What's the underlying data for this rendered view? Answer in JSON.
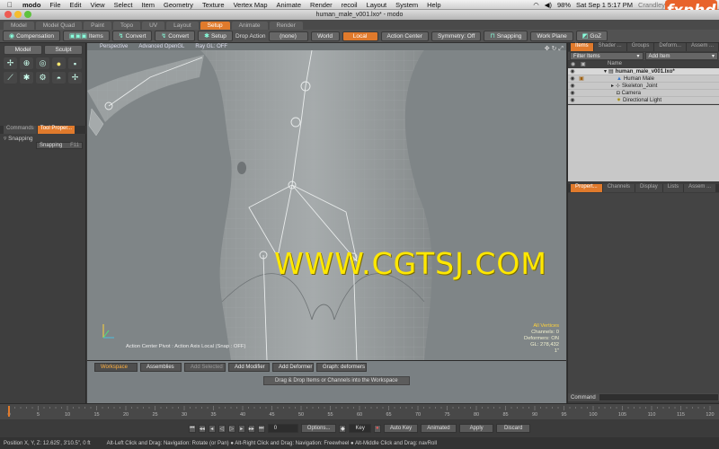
{
  "mac_menu": {
    "app": "modo",
    "items": [
      "File",
      "Edit",
      "View",
      "Select",
      "Item",
      "Geometry",
      "Texture",
      "Vertex Map",
      "Animate",
      "Render",
      "recoil",
      "Layout",
      "System",
      "Help"
    ],
    "battery": "98%",
    "clock": "Sat Sep 1  5:17 PM",
    "user": "Crandley"
  },
  "logo_text": "fxphd",
  "window_title": "human_male_v001.lxo* - modo",
  "layout_tabs": [
    "Model",
    "Model Quad",
    "Paint",
    "Topo",
    "UV",
    "Layout",
    "Setup",
    "Animate",
    "Render"
  ],
  "active_layout_tab": "Setup",
  "toolbar": {
    "compensation": "Compensation",
    "items": "Items",
    "convert1": "Convert",
    "convert2": "Convert",
    "setup": "Setup",
    "drop_action_label": "Drop Action",
    "drop_action_value": "(none)",
    "world": "World",
    "local": "Local",
    "action_center": "Action Center",
    "symmetry": "Symmetry: Off",
    "snapping": "Snapping",
    "work_plane": "Work Plane",
    "goz": "GoZ"
  },
  "left_panel": {
    "modes": [
      "Model",
      "Sculpt"
    ],
    "tabs": [
      "Commands",
      "Tool Proper..."
    ],
    "section": "Snapping",
    "snapping_button": "Snapping",
    "snapping_key": "F11"
  },
  "viewport": {
    "header": [
      "Perspective",
      "Advanced OpenGL",
      "Ray GL: OFF"
    ],
    "pivot_text": "Action Center Pivot : Action Axis Local  (Snap : OFF)",
    "info_selected": "All Vertices",
    "info_lines": [
      "Channels: 0",
      "Deformers: ON",
      "GL: 278,432",
      "1\""
    ],
    "watermark": "WWW.CGTSJ.COM"
  },
  "workspace": {
    "tabs": [
      "Workspace",
      "Assemblies",
      "Add Selected",
      "Add Modifier",
      "Add Deformer",
      "Graph: deformers"
    ],
    "hint": "Drag & Drop Items or Channels into the Workspace"
  },
  "right_panel": {
    "top_tabs": [
      "Items",
      "Shader ...",
      "Groups",
      "Deform...",
      "Assem ..."
    ],
    "filter_items": "Filter Items",
    "add_item": "Add Item",
    "column_name": "Name",
    "items": [
      {
        "label": "human_male_v001.lxo*",
        "indent": 0,
        "root": true
      },
      {
        "label": "Human Male",
        "indent": 1
      },
      {
        "label": "Skeleton_Joint",
        "indent": 1
      },
      {
        "label": "Camera",
        "indent": 1
      },
      {
        "label": "Directional Light",
        "indent": 1
      }
    ],
    "bottom_tabs": [
      "Propert...",
      "Channels",
      "Display",
      "Lists",
      "Assem ..."
    ],
    "command_label": "Command"
  },
  "timeline": {
    "ticks": [
      "0",
      "5",
      "10",
      "15",
      "20",
      "25",
      "30",
      "35",
      "40",
      "45",
      "50",
      "55",
      "60",
      "65",
      "70",
      "75",
      "80",
      "85",
      "90",
      "95",
      "100",
      "105",
      "110",
      "115",
      "120"
    ]
  },
  "transport": {
    "frame": "0",
    "options": "Options...",
    "key": "Key",
    "auto_key": "Auto Key",
    "animated": "Animated",
    "apply": "Apply",
    "discard": "Discard"
  },
  "status": {
    "position": "Position X, Y, Z:  12.625', 3'10.5\", 0 ft",
    "hint": "Alt-Left Click and Drag: Navigation: Rotate (or Pan)  ●  Alt-Right Click and Drag: Navigation: Freewheel  ●  Alt-Middle Click and Drag: navRoll"
  },
  "colors": {
    "accent": "#e07a2c",
    "viewport_bg": "#7f8587",
    "watermark": "#ffe800"
  }
}
